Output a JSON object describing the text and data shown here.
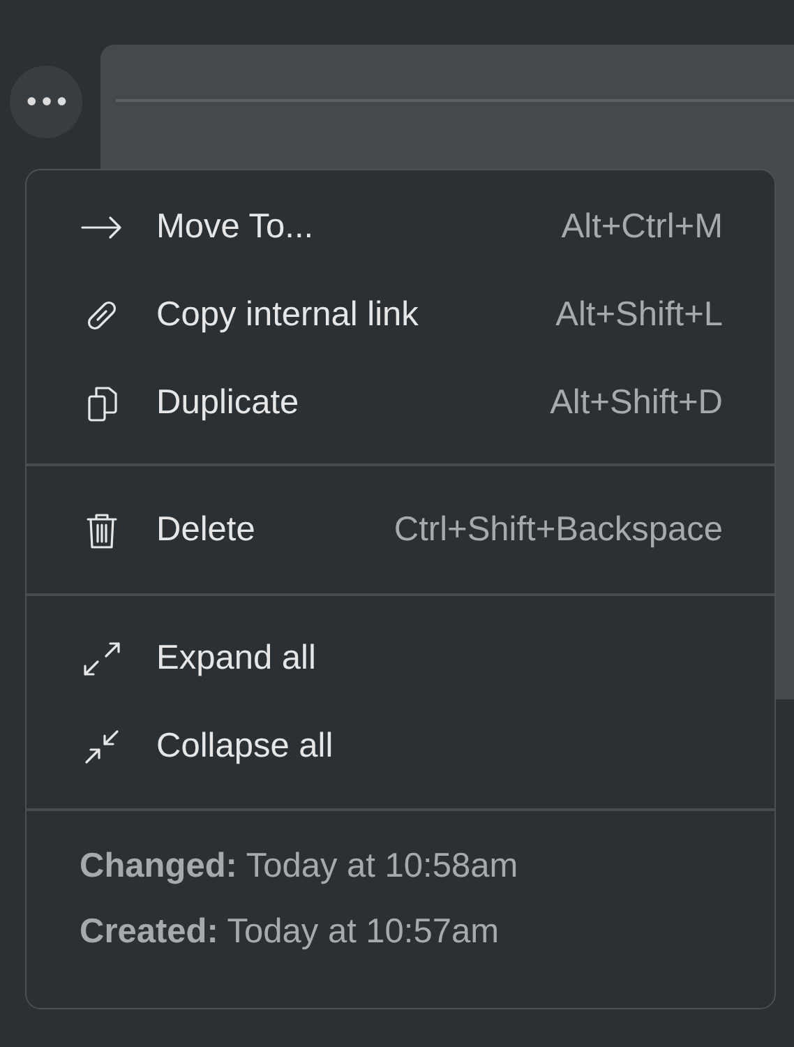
{
  "more_button": {
    "label": "•••"
  },
  "menu": {
    "groups": [
      {
        "items": [
          {
            "label": "Move To...",
            "shortcut": "Alt+Ctrl+M"
          },
          {
            "label": "Copy internal link",
            "shortcut": "Alt+Shift+L"
          },
          {
            "label": "Duplicate",
            "shortcut": "Alt+Shift+D"
          }
        ]
      },
      {
        "items": [
          {
            "label": "Delete",
            "shortcut": "Ctrl+Shift+Backspace"
          }
        ]
      },
      {
        "items": [
          {
            "label": "Expand all"
          },
          {
            "label": "Collapse all"
          }
        ]
      }
    ],
    "info": [
      "**Changed:** Today at 10:58am",
      "**Created:** Today at 10:57am"
    ]
  }
}
